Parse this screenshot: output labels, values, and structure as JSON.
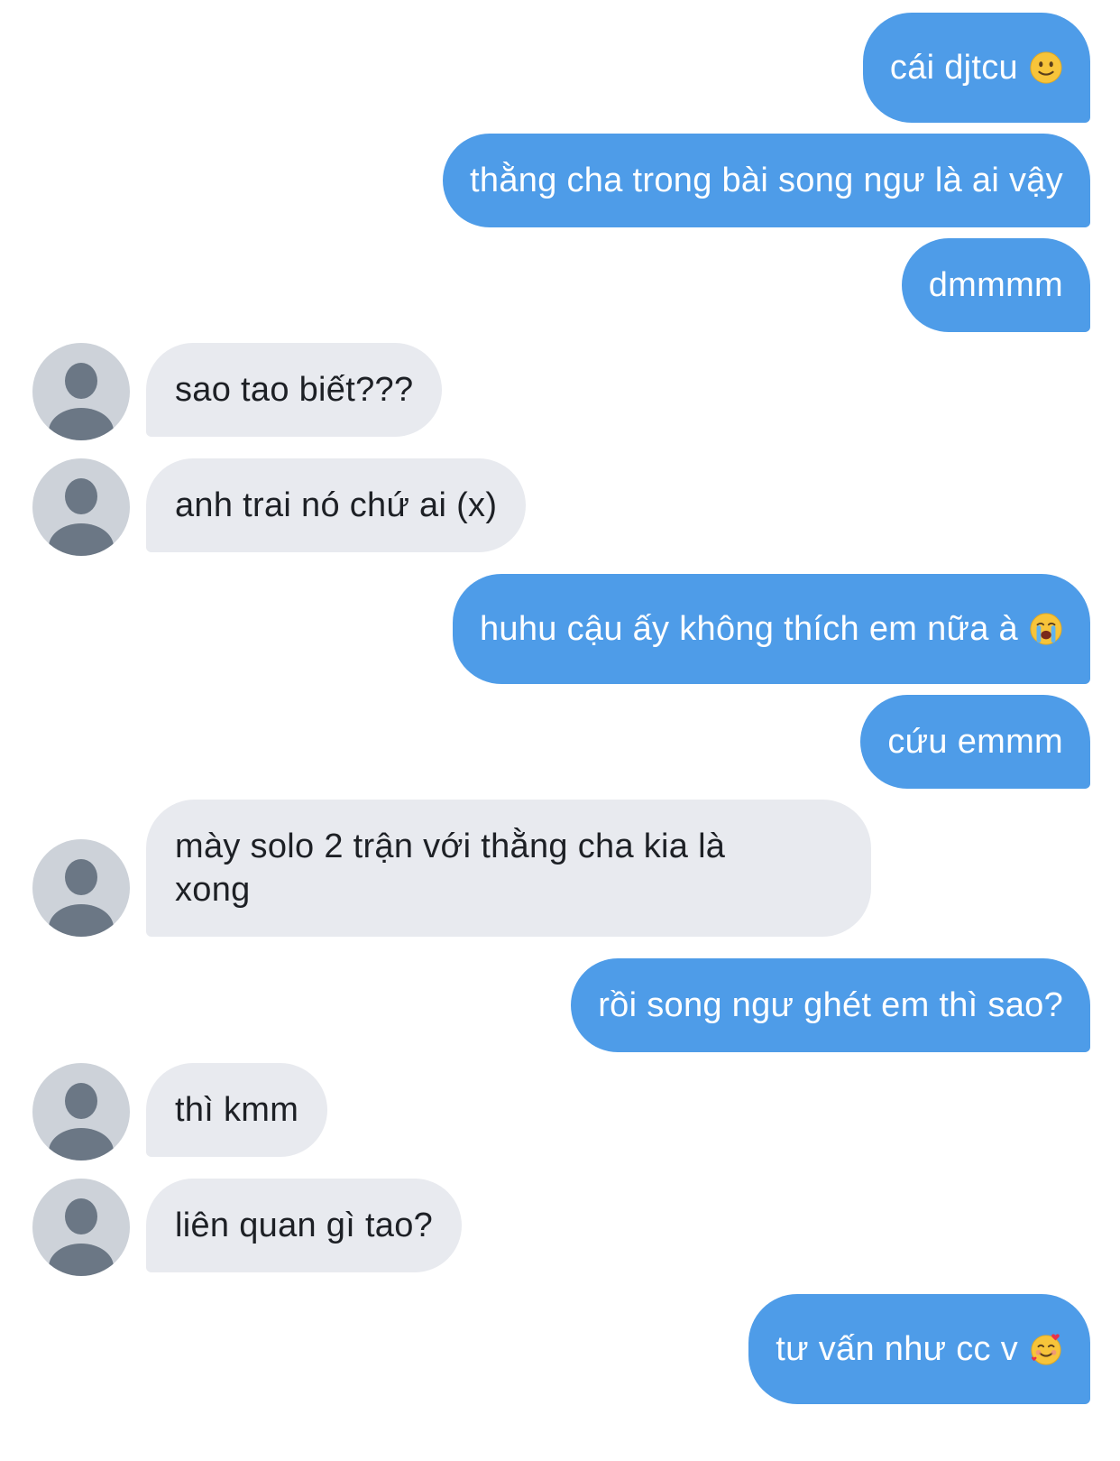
{
  "messages": [
    {
      "side": "out",
      "text": "cái djtcu",
      "emoji": "slightly-smiling-face-icon"
    },
    {
      "side": "out",
      "text": "thằng cha trong bài song ngư là ai vậy"
    },
    {
      "side": "out",
      "text": "dmmmm"
    },
    {
      "side": "in",
      "text": "sao tao biết???"
    },
    {
      "side": "in",
      "text": "anh trai nó chứ ai (x)"
    },
    {
      "side": "out",
      "text": "huhu cậu ấy không thích em nữa à",
      "emoji": "loudly-crying-face-icon"
    },
    {
      "side": "out",
      "text": "cứu emmm"
    },
    {
      "side": "in",
      "text": "mày solo 2 trận với thằng cha kia là xong"
    },
    {
      "side": "out",
      "text": "rồi song ngư ghét em thì sao?"
    },
    {
      "side": "in",
      "text": "thì kmm"
    },
    {
      "side": "in",
      "text": "liên quan gì tao?"
    },
    {
      "side": "out",
      "text": "tư vấn như cc v",
      "emoji": "smiling-face-with-hearts-icon"
    }
  ],
  "colors": {
    "outgoing_bubble": "#4e9ce8",
    "incoming_bubble": "#e8eaef",
    "avatar_bg": "#cdd2d9",
    "avatar_figure": "#6b7785"
  }
}
